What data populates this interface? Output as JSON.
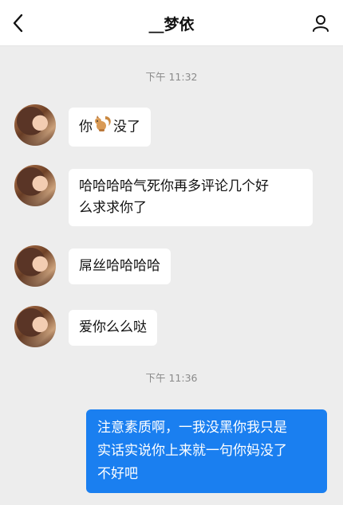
{
  "header": {
    "title": "__梦依",
    "back_icon": "chevron-left-icon",
    "profile_icon": "user-icon"
  },
  "timestamps": [
    "下午 11:32",
    "下午 11:36"
  ],
  "messages": [
    {
      "side": "in",
      "text_before": "你",
      "emoji": "squirrel-emoji",
      "text_after": "没了"
    },
    {
      "side": "in",
      "lines": [
        "哈哈哈哈气死你再多评论几个好",
        "么求求你了"
      ]
    },
    {
      "side": "in",
      "text": "屌丝哈哈哈哈"
    },
    {
      "side": "in",
      "text": "爱你么么哒"
    },
    {
      "side": "out",
      "lines": [
        "注意素质啊，一我没黑你我只是",
        "实话实说你上来就一句你妈没了",
        "不好吧"
      ]
    }
  ],
  "colors": {
    "background": "#ededed",
    "incoming_bubble": "#ffffff",
    "outgoing_bubble": "#1a7ff0"
  }
}
